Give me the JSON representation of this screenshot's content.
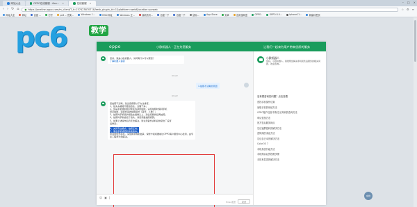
{
  "browser": {
    "tabs": [
      {
        "label": "网站大全"
      },
      {
        "label": "OPPO在线客服 - 6an..."
      },
      {
        "label": "在线客服"
      }
    ],
    "url": "https://oneline.oppo.com/m_client/?_t=15742387071&fresh_plugin_id=1&platform=web&location=pcweb",
    "bookmarks": [
      "网址大全",
      "网址",
      "百度 ...",
      "打开",
      "pc6 -- 完美...",
      "Windows 1...",
      "MSN 网址",
      "Windows 正...",
      "最新资讯...",
      "百度一下",
      "百度一下",
      "鼠标...",
      "App Store",
      "安卓",
      "应用宝网盘",
      "OPPO..",
      "OPPO 8.0...",
      "iphone11...",
      "新建标签页"
    ]
  },
  "logo": {
    "text": "pc6",
    "badge": "教学"
  },
  "chat": {
    "brand": "oppo",
    "header_title": "小欧机器人 · 正在为您服务",
    "header_sub": "让我们一起来为用户带来优质的服务",
    "welcome": [
      "您好，我是小欧机器人，请问有什么可以帮您？",
      "了解机器人答疑"
    ],
    "time1": "09:22",
    "user_message": "1.拍照不清晰的原因",
    "time2": "09:22",
    "answer_intro": "您拍照不清晰，建议您按照以下方法排查：",
    "answer_lines": [
      "1、镜头头模组不要遮挡住，清理干净；",
      "2、您是手机或拍摄对象在抖动时拍照，请您拍照时保持手机",
      "稳定拍摄，选择合适的拍照模式（夜景、人像）；",
      "3、拍照时手机保护膜贴在摄像头上，建议您撕掉后再拍照；",
      "4、拍照时手指遮挡了镜头，请您调整拍照姿势；",
      "5、如果上述操作后仍无法解决，建议您备份资料后恢复出厂设置",
      "后重试；"
    ],
    "highlight_lines": [
      "6、关闭专业模式，拍照正常；",
      "7、重启手机或更新系统版本。"
    ],
    "answer_outro": "若问题依然存在，请您携带购机发票，保修卡和机器前往OPPO客户服务中心检测，由专业工程师为您解决。",
    "send_hint": "Enter发送",
    "send_label": "发送",
    "side_name": "小欧机器人",
    "side_desc": "您好，小欧机器人，我能帮您解决手机和售后服务的相关问题，欢迎咨询~",
    "side_q_title": "没有想咨询的问题？点击查看",
    "side_questions": [
      "查找手机操作位置",
      "读取手机的系统方法",
      "OPPO账户信息不慎/忘记号码的查询方法",
      "申请查找方法",
      "官方售后服务网点",
      "忘记锁屏密码的解决方法",
      "查阿用的消息方法",
      "忘记自己ID的解决方法",
      "ColorOS 7",
      "手机系统升级方法",
      "手机购买后的权限步骤",
      "手机有发烫的解决方法"
    ],
    "float_label": "在线"
  }
}
